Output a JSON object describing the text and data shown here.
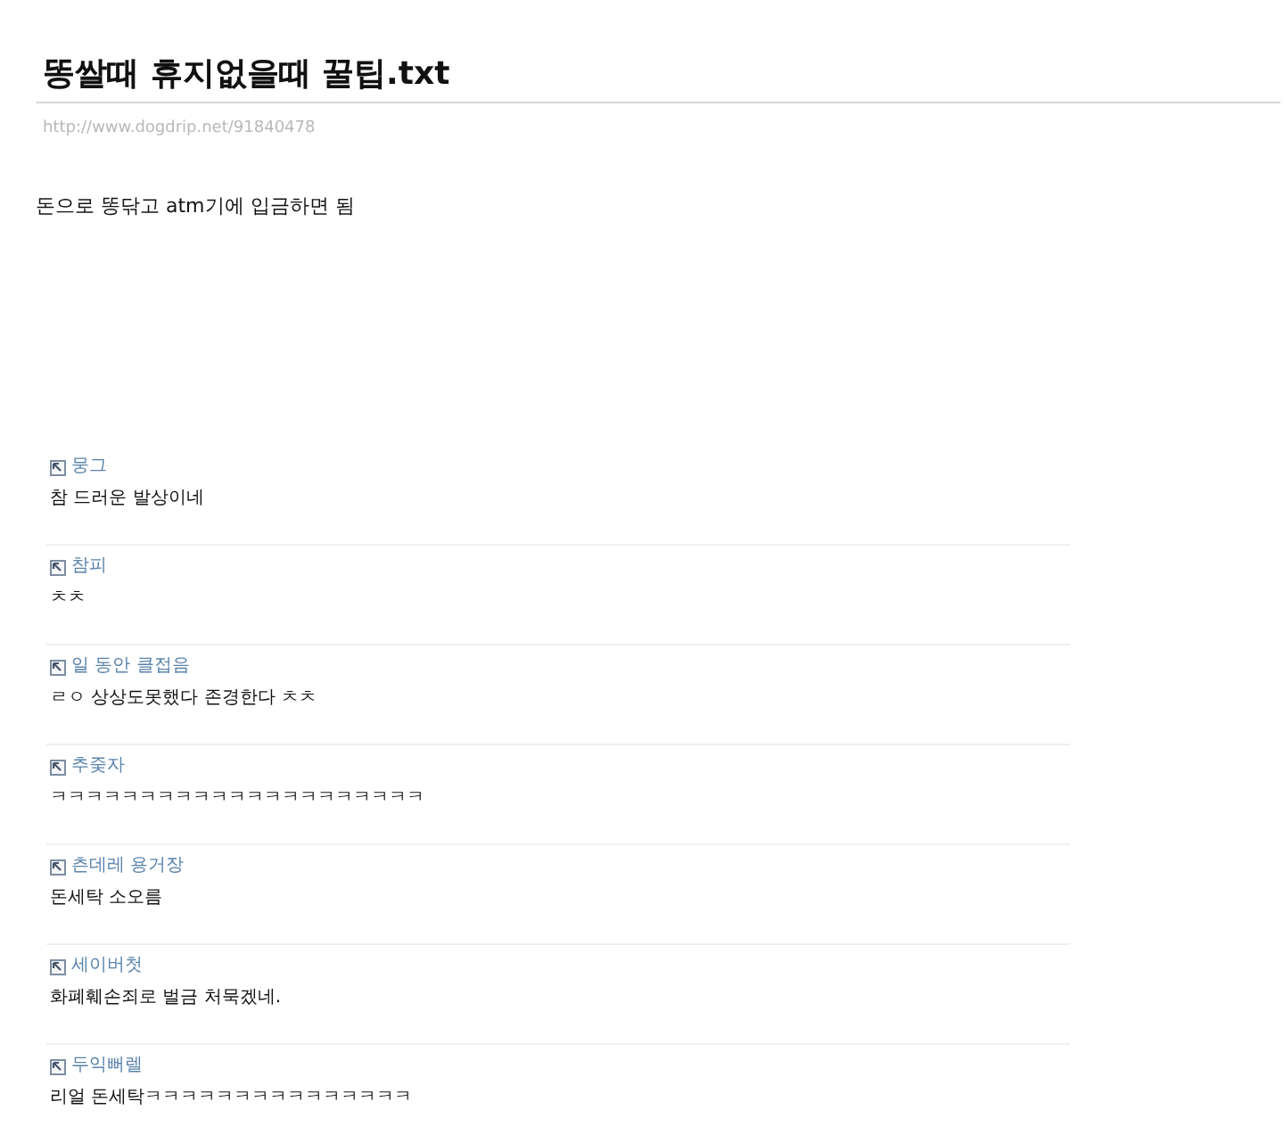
{
  "post": {
    "title": "똥쌀때 휴지없을때 꿀팁.txt",
    "source_url": "http://www.dogdrip.net/91840478",
    "body": "돈으로 똥닦고 atm기에 입금하면 됨"
  },
  "comments": [
    {
      "author": "뭉그",
      "text": "참 드러운 발상이네"
    },
    {
      "author": "참피",
      "text": "ㅊㅊ"
    },
    {
      "author": "일 동안 클접음",
      "text": "ㄹㅇ 상상도못했다 존경한다 ㅊㅊ"
    },
    {
      "author": "추줒자",
      "text": "ㅋㅋㅋㅋㅋㅋㅋㅋㅋㅋㅋㅋㅋㅋㅋㅋㅋㅋㅋㅋㅋ"
    },
    {
      "author": "츤데레 용거장",
      "text": "돈세탁 소오름"
    },
    {
      "author": "세이버첫",
      "text": "화폐훼손죄로 벌금 처묵겠네."
    },
    {
      "author": "두익뻐렐",
      "text": "리얼 돈세탁ㅋㅋㅋㅋㅋㅋㅋㅋㅋㅋㅋㅋㅋㅋㅋ"
    }
  ]
}
